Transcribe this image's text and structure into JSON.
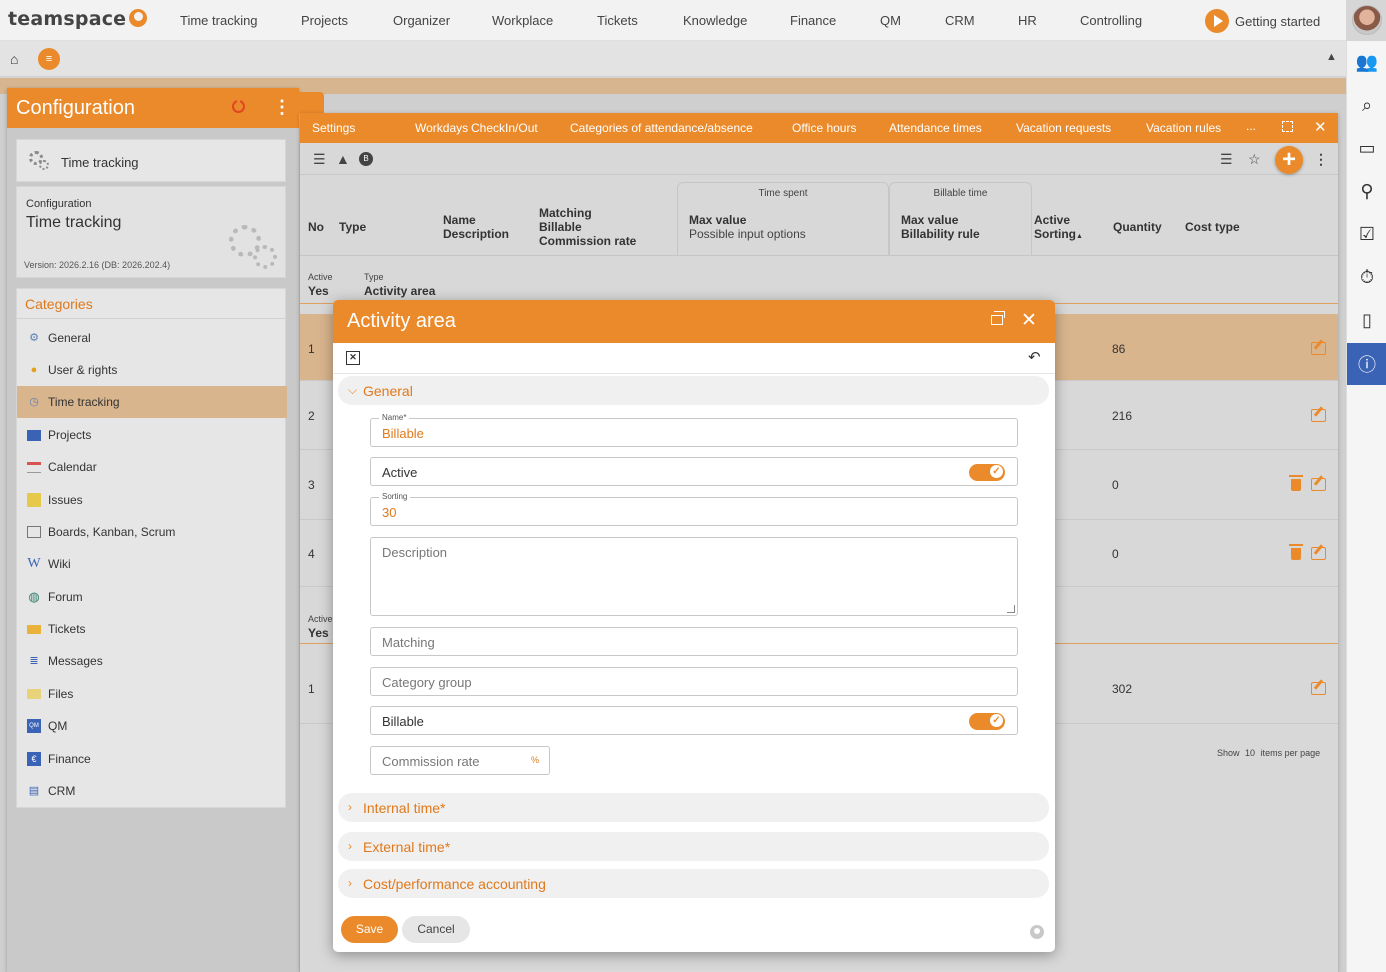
{
  "app": {
    "logo": "teamspace",
    "getting_started": "Getting started"
  },
  "nav": [
    "Time tracking",
    "Projects",
    "Organizer",
    "Workplace",
    "Tickets",
    "Knowledge",
    "Finance",
    "QM",
    "CRM",
    "HR",
    "Controlling"
  ],
  "config": {
    "title": "Configuration",
    "tt_card_label": "Time tracking",
    "info_sub": "Configuration",
    "info_title": "Time tracking",
    "version": "Version: 2026.2.16 (DB: 2026.202.4)",
    "categories_title": "Categories",
    "categories": [
      {
        "label": "General",
        "icon": "gears-icon"
      },
      {
        "label": "User & rights",
        "icon": "users-icon"
      },
      {
        "label": "Time tracking",
        "icon": "stopwatch-icon"
      },
      {
        "label": "Projects",
        "icon": "folder-icon"
      },
      {
        "label": "Calendar",
        "icon": "calendar-icon"
      },
      {
        "label": "Issues",
        "icon": "note-icon"
      },
      {
        "label": "Boards, Kanban, Scrum",
        "icon": "board-icon"
      },
      {
        "label": "Wiki",
        "icon": "wiki-icon"
      },
      {
        "label": "Forum",
        "icon": "forum-icon"
      },
      {
        "label": "Tickets",
        "icon": "ticket-icon"
      },
      {
        "label": "Messages",
        "icon": "messages-icon"
      },
      {
        "label": "Files",
        "icon": "files-icon"
      },
      {
        "label": "QM",
        "icon": "qm-icon"
      },
      {
        "label": "Finance",
        "icon": "finance-icon"
      },
      {
        "label": "CRM",
        "icon": "crm-icon"
      }
    ]
  },
  "tabs": [
    "Settings",
    "Workdays",
    "CheckIn/Out",
    "Categories of attendance/absence",
    "Office hours",
    "Attendance times",
    "Vacation requests",
    "Vacation rules"
  ],
  "tab_more": "...",
  "grid": {
    "headers": {
      "no": "No",
      "type": "Type",
      "name": "Name",
      "description": "Description",
      "matching": "Matching",
      "billable": "Billable",
      "commission": "Commission rate",
      "time_spent": "Time spent",
      "max_value": "Max value",
      "input_options": "Possible input options",
      "billable_time": "Billable time",
      "max_value2": "Max value",
      "billability_rule": "Billability rule",
      "active": "Active",
      "sorting": "Sorting",
      "quantity": "Quantity",
      "cost_type": "Cost type"
    },
    "group1": {
      "active_label": "Active",
      "active_value": "Yes",
      "type_label": "Type",
      "type_value": "Activity area"
    },
    "rows1": [
      {
        "no": "1",
        "qty": "86"
      },
      {
        "no": "2",
        "qty": "216"
      },
      {
        "no": "3",
        "qty": "0"
      },
      {
        "no": "4",
        "qty": "0"
      }
    ],
    "group2": {
      "active_label": "Active",
      "active_value": "Yes"
    },
    "rows2": [
      {
        "no": "1",
        "qty": "302"
      }
    ],
    "pager": {
      "show": "Show",
      "count": "10",
      "suffix": "items per page"
    }
  },
  "dialog": {
    "title": "Activity area",
    "sections": {
      "general": "General",
      "internal": "Internal time*",
      "external": "External time*",
      "cost": "Cost/performance accounting"
    },
    "fields": {
      "name_label": "Name*",
      "name_value": "Billable",
      "active_label": "Active",
      "sorting_label": "Sorting",
      "sorting_value": "30",
      "description_ph": "Description",
      "matching_ph": "Matching",
      "category_group_ph": "Category group",
      "billable_label": "Billable",
      "commission_ph": "Commission rate",
      "commission_unit": "%"
    },
    "save": "Save",
    "cancel": "Cancel"
  },
  "colors": {
    "accent": "#ea8a2b",
    "highlight": "#d9b58d",
    "info_active": "#3a63b5"
  }
}
